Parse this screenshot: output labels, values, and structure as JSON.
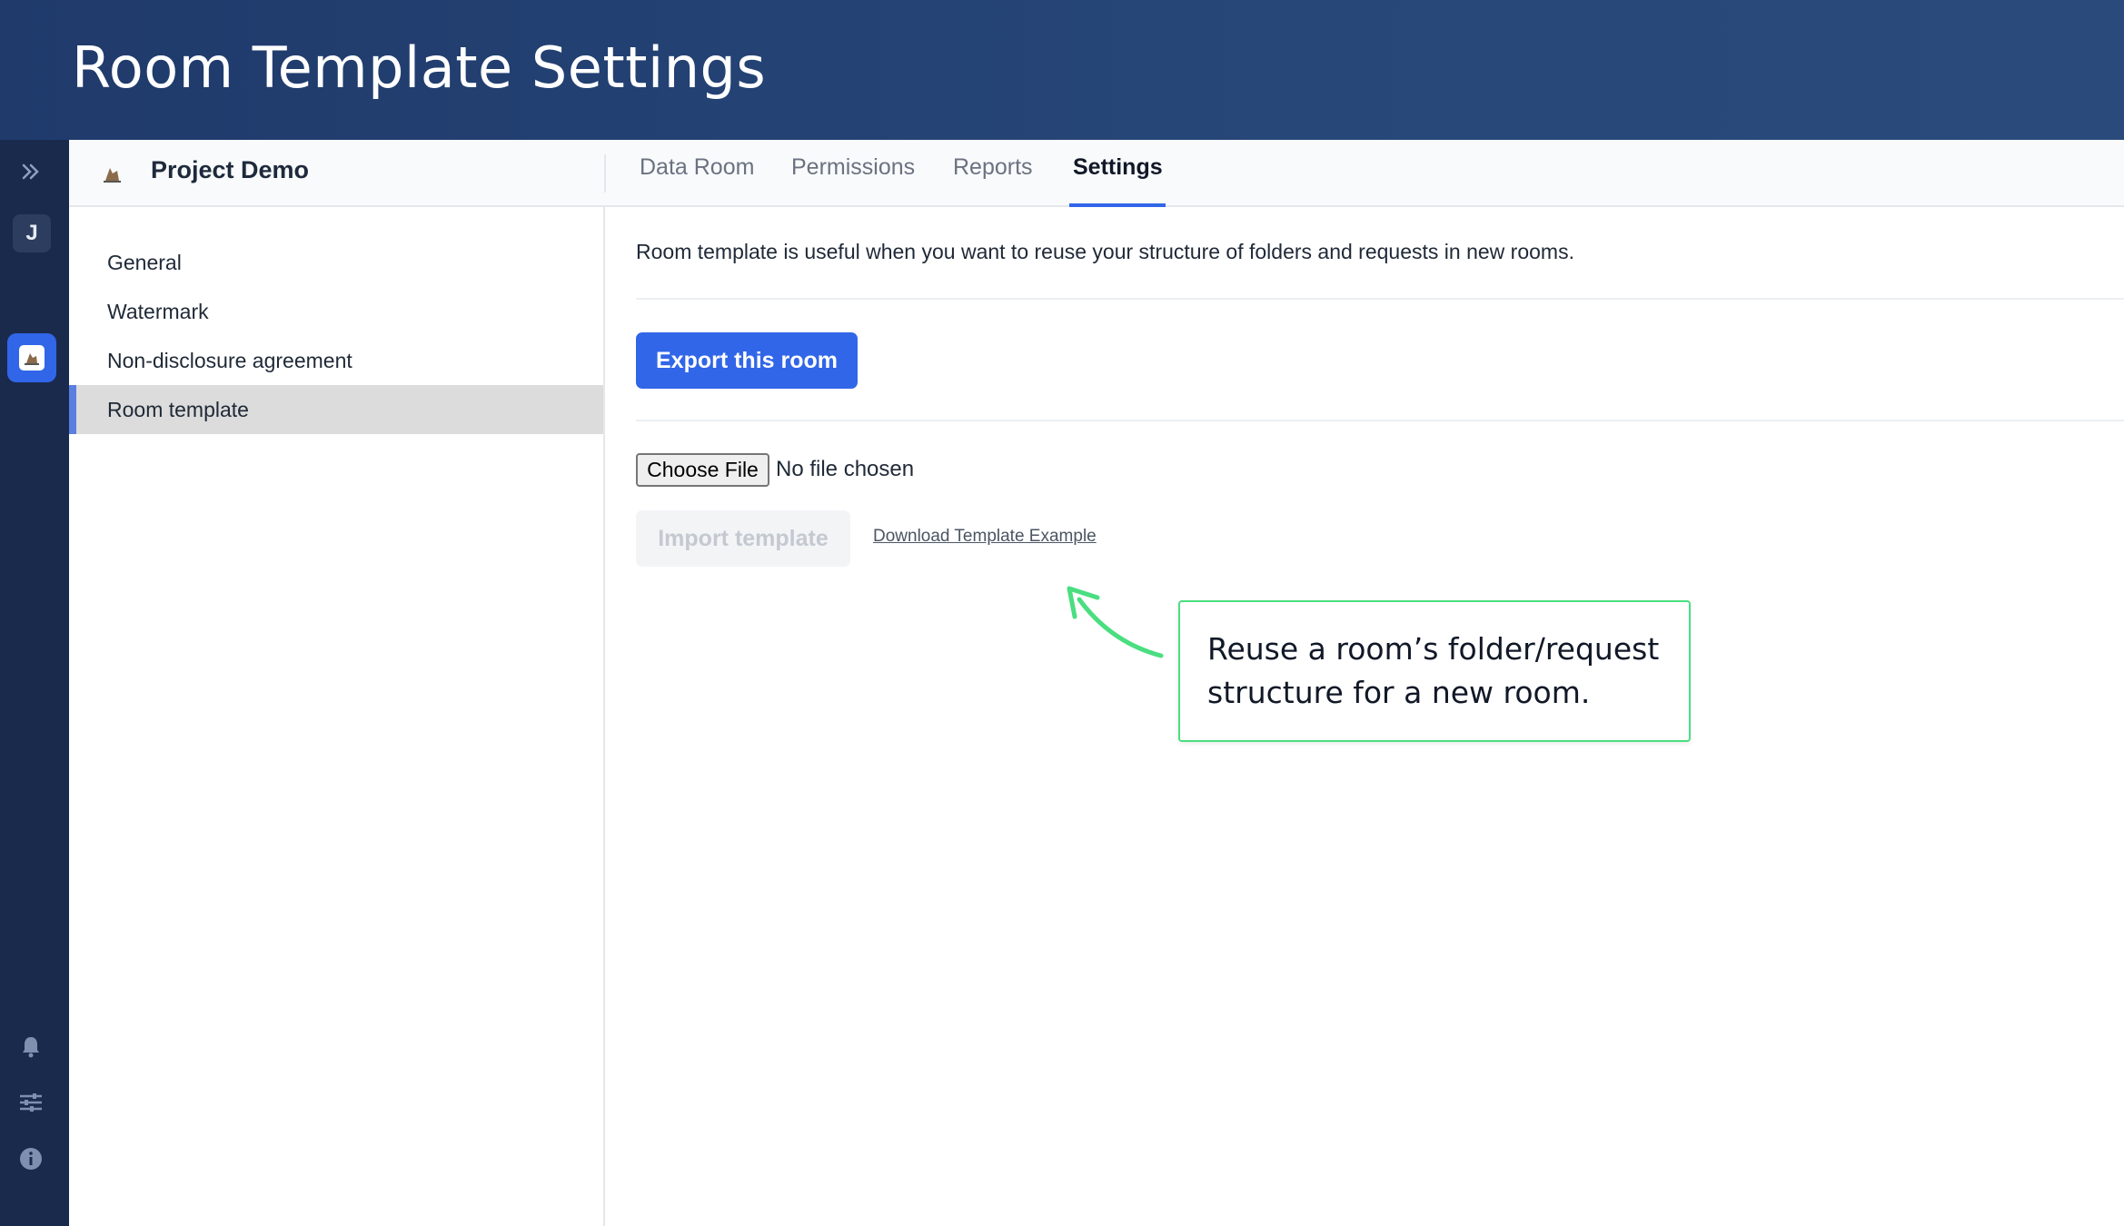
{
  "banner": {
    "title": "Room Template Settings"
  },
  "rail": {
    "avatar_initial": "J",
    "icons": [
      "chevrons-right-icon",
      "app-logo-icon",
      "bell-icon",
      "sliders-icon",
      "info-icon"
    ]
  },
  "project": {
    "name": "Project Demo"
  },
  "tabs": [
    {
      "label": "Data Room"
    },
    {
      "label": "Permissions"
    },
    {
      "label": "Reports"
    },
    {
      "label": "Settings",
      "active": true
    }
  ],
  "sidebar": {
    "items": [
      {
        "label": "General"
      },
      {
        "label": "Watermark"
      },
      {
        "label": "Non-disclosure agreement"
      },
      {
        "label": "Room template",
        "active": true
      }
    ]
  },
  "main": {
    "description": "Room template is useful when you want to reuse your structure of folders and requests in new rooms.",
    "export_label": "Export this room",
    "choose_file_label": "Choose File",
    "file_status": "No file chosen",
    "import_label": "Import template",
    "download_link": "Download Template Example"
  },
  "callout": {
    "text": "Reuse a room’s folder/request structure for a new room."
  },
  "colors": {
    "banner": "#274779",
    "rail": "#1a2a4d",
    "accent": "#3166e8",
    "callout_border": "#4ade80"
  }
}
